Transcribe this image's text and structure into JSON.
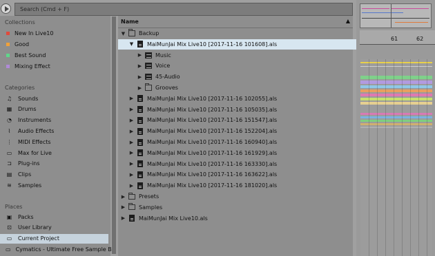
{
  "search": {
    "placeholder": "Search (Cmd + F)"
  },
  "sidebar": {
    "collections_title": "Collections",
    "collections": [
      {
        "label": "New In Live10",
        "color": "#e04a3c"
      },
      {
        "label": "Good",
        "color": "#f0a13a"
      },
      {
        "label": "Best Sound",
        "color": "#5fd68a"
      },
      {
        "label": "Mixing Effect",
        "color": "#b08ad8"
      }
    ],
    "categories_title": "Categories",
    "categories": [
      {
        "label": "Sounds",
        "icon": "music-notes-icon"
      },
      {
        "label": "Drums",
        "icon": "drum-grid-icon"
      },
      {
        "label": "Instruments",
        "icon": "clock-icon"
      },
      {
        "label": "Audio Effects",
        "icon": "audio-effects-icon"
      },
      {
        "label": "MIDI Effects",
        "icon": "midi-effects-icon"
      },
      {
        "label": "Max for Live",
        "icon": "max-for-live-icon"
      },
      {
        "label": "Plug-ins",
        "icon": "plug-in-icon"
      },
      {
        "label": "Clips",
        "icon": "clips-icon"
      },
      {
        "label": "Samples",
        "icon": "samples-icon"
      }
    ],
    "places_title": "Places",
    "places": [
      {
        "label": "Packs",
        "icon": "packs-icon"
      },
      {
        "label": "User Library",
        "icon": "user-library-icon"
      },
      {
        "label": "Current Project",
        "icon": "current-project-icon"
      },
      {
        "label": "Cymatics - Ultimate Free Sample Bu",
        "icon": "folder-icon"
      }
    ]
  },
  "browser": {
    "column_header": "Name",
    "sort_arrow": "▲",
    "rows": [
      {
        "label": "Backup",
        "indent": 0,
        "expanded": true,
        "icon": "backup-folder"
      },
      {
        "label": "MaiMunJai Mix Live10 [2017-11-16 101608].als",
        "indent": 1,
        "expanded": true,
        "icon": "doc",
        "selected": true
      },
      {
        "label": "Music",
        "indent": 2,
        "expanded": false,
        "icon": "filled-folder"
      },
      {
        "label": "Voice",
        "indent": 2,
        "expanded": false,
        "icon": "filled-folder"
      },
      {
        "label": "45-Audio",
        "indent": 2,
        "expanded": false,
        "icon": "filled-folder"
      },
      {
        "label": "Grooves",
        "indent": 2,
        "expanded": false,
        "icon": "grooves-folder"
      },
      {
        "label": "MaiMunJai Mix Live10 [2017-11-16 102055].als",
        "indent": 1,
        "expanded": false,
        "icon": "doc"
      },
      {
        "label": "MaiMunJai Mix Live10 [2017-11-16 105035].als",
        "indent": 1,
        "expanded": false,
        "icon": "doc"
      },
      {
        "label": "MaiMunJai Mix Live10 [2017-11-16 151547].als",
        "indent": 1,
        "expanded": false,
        "icon": "doc"
      },
      {
        "label": "MaiMunJai Mix Live10 [2017-11-16 152204].als",
        "indent": 1,
        "expanded": false,
        "icon": "doc"
      },
      {
        "label": "MaiMunJai Mix Live10 [2017-11-16 160940].als",
        "indent": 1,
        "expanded": false,
        "icon": "doc"
      },
      {
        "label": "MaiMunJai Mix Live10 [2017-11-16 161929].als",
        "indent": 1,
        "expanded": false,
        "icon": "doc"
      },
      {
        "label": "MaiMunJai Mix Live10 [2017-11-16 163330].als",
        "indent": 1,
        "expanded": false,
        "icon": "doc"
      },
      {
        "label": "MaiMunJai Mix Live10 [2017-11-16 163622].als",
        "indent": 1,
        "expanded": false,
        "icon": "doc"
      },
      {
        "label": "MaiMunJai Mix Live10 [2017-11-16 181020].als",
        "indent": 1,
        "expanded": false,
        "icon": "doc"
      },
      {
        "label": "Presets",
        "indent": 0,
        "expanded": false,
        "icon": "folder"
      },
      {
        "label": "Samples",
        "indent": 0,
        "expanded": false,
        "icon": "folder"
      },
      {
        "label": "MaiMunJai Mix Live10.als",
        "indent": 0,
        "expanded": false,
        "icon": "doc"
      }
    ]
  },
  "arrangement": {
    "ruler_labels": [
      "61",
      "62"
    ]
  },
  "colors": {
    "selected_row": "#d7e6f0",
    "selected_place": "#c6d3dd"
  }
}
